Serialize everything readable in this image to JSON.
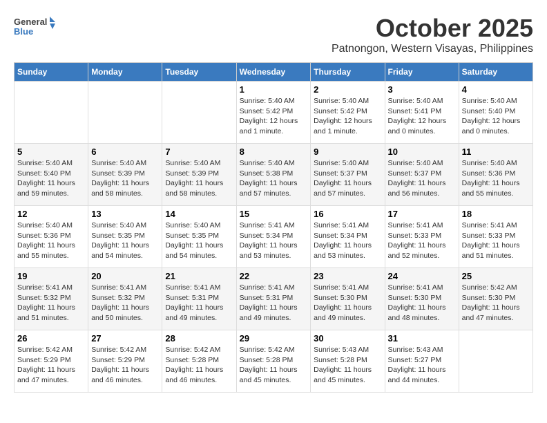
{
  "header": {
    "logo_general": "General",
    "logo_blue": "Blue",
    "month_title": "October 2025",
    "location": "Patnongon, Western Visayas, Philippines"
  },
  "days_of_week": [
    "Sunday",
    "Monday",
    "Tuesday",
    "Wednesday",
    "Thursday",
    "Friday",
    "Saturday"
  ],
  "weeks": [
    [
      {
        "day": "",
        "info": ""
      },
      {
        "day": "",
        "info": ""
      },
      {
        "day": "",
        "info": ""
      },
      {
        "day": "1",
        "info": "Sunrise: 5:40 AM\nSunset: 5:42 PM\nDaylight: 12 hours\nand 1 minute."
      },
      {
        "day": "2",
        "info": "Sunrise: 5:40 AM\nSunset: 5:42 PM\nDaylight: 12 hours\nand 1 minute."
      },
      {
        "day": "3",
        "info": "Sunrise: 5:40 AM\nSunset: 5:41 PM\nDaylight: 12 hours\nand 0 minutes."
      },
      {
        "day": "4",
        "info": "Sunrise: 5:40 AM\nSunset: 5:40 PM\nDaylight: 12 hours\nand 0 minutes."
      }
    ],
    [
      {
        "day": "5",
        "info": "Sunrise: 5:40 AM\nSunset: 5:40 PM\nDaylight: 11 hours\nand 59 minutes."
      },
      {
        "day": "6",
        "info": "Sunrise: 5:40 AM\nSunset: 5:39 PM\nDaylight: 11 hours\nand 58 minutes."
      },
      {
        "day": "7",
        "info": "Sunrise: 5:40 AM\nSunset: 5:39 PM\nDaylight: 11 hours\nand 58 minutes."
      },
      {
        "day": "8",
        "info": "Sunrise: 5:40 AM\nSunset: 5:38 PM\nDaylight: 11 hours\nand 57 minutes."
      },
      {
        "day": "9",
        "info": "Sunrise: 5:40 AM\nSunset: 5:37 PM\nDaylight: 11 hours\nand 57 minutes."
      },
      {
        "day": "10",
        "info": "Sunrise: 5:40 AM\nSunset: 5:37 PM\nDaylight: 11 hours\nand 56 minutes."
      },
      {
        "day": "11",
        "info": "Sunrise: 5:40 AM\nSunset: 5:36 PM\nDaylight: 11 hours\nand 55 minutes."
      }
    ],
    [
      {
        "day": "12",
        "info": "Sunrise: 5:40 AM\nSunset: 5:36 PM\nDaylight: 11 hours\nand 55 minutes."
      },
      {
        "day": "13",
        "info": "Sunrise: 5:40 AM\nSunset: 5:35 PM\nDaylight: 11 hours\nand 54 minutes."
      },
      {
        "day": "14",
        "info": "Sunrise: 5:40 AM\nSunset: 5:35 PM\nDaylight: 11 hours\nand 54 minutes."
      },
      {
        "day": "15",
        "info": "Sunrise: 5:41 AM\nSunset: 5:34 PM\nDaylight: 11 hours\nand 53 minutes."
      },
      {
        "day": "16",
        "info": "Sunrise: 5:41 AM\nSunset: 5:34 PM\nDaylight: 11 hours\nand 53 minutes."
      },
      {
        "day": "17",
        "info": "Sunrise: 5:41 AM\nSunset: 5:33 PM\nDaylight: 11 hours\nand 52 minutes."
      },
      {
        "day": "18",
        "info": "Sunrise: 5:41 AM\nSunset: 5:33 PM\nDaylight: 11 hours\nand 51 minutes."
      }
    ],
    [
      {
        "day": "19",
        "info": "Sunrise: 5:41 AM\nSunset: 5:32 PM\nDaylight: 11 hours\nand 51 minutes."
      },
      {
        "day": "20",
        "info": "Sunrise: 5:41 AM\nSunset: 5:32 PM\nDaylight: 11 hours\nand 50 minutes."
      },
      {
        "day": "21",
        "info": "Sunrise: 5:41 AM\nSunset: 5:31 PM\nDaylight: 11 hours\nand 49 minutes."
      },
      {
        "day": "22",
        "info": "Sunrise: 5:41 AM\nSunset: 5:31 PM\nDaylight: 11 hours\nand 49 minutes."
      },
      {
        "day": "23",
        "info": "Sunrise: 5:41 AM\nSunset: 5:30 PM\nDaylight: 11 hours\nand 49 minutes."
      },
      {
        "day": "24",
        "info": "Sunrise: 5:41 AM\nSunset: 5:30 PM\nDaylight: 11 hours\nand 48 minutes."
      },
      {
        "day": "25",
        "info": "Sunrise: 5:42 AM\nSunset: 5:30 PM\nDaylight: 11 hours\nand 47 minutes."
      }
    ],
    [
      {
        "day": "26",
        "info": "Sunrise: 5:42 AM\nSunset: 5:29 PM\nDaylight: 11 hours\nand 47 minutes."
      },
      {
        "day": "27",
        "info": "Sunrise: 5:42 AM\nSunset: 5:29 PM\nDaylight: 11 hours\nand 46 minutes."
      },
      {
        "day": "28",
        "info": "Sunrise: 5:42 AM\nSunset: 5:28 PM\nDaylight: 11 hours\nand 46 minutes."
      },
      {
        "day": "29",
        "info": "Sunrise: 5:42 AM\nSunset: 5:28 PM\nDaylight: 11 hours\nand 45 minutes."
      },
      {
        "day": "30",
        "info": "Sunrise: 5:43 AM\nSunset: 5:28 PM\nDaylight: 11 hours\nand 45 minutes."
      },
      {
        "day": "31",
        "info": "Sunrise: 5:43 AM\nSunset: 5:27 PM\nDaylight: 11 hours\nand 44 minutes."
      },
      {
        "day": "",
        "info": ""
      }
    ]
  ]
}
